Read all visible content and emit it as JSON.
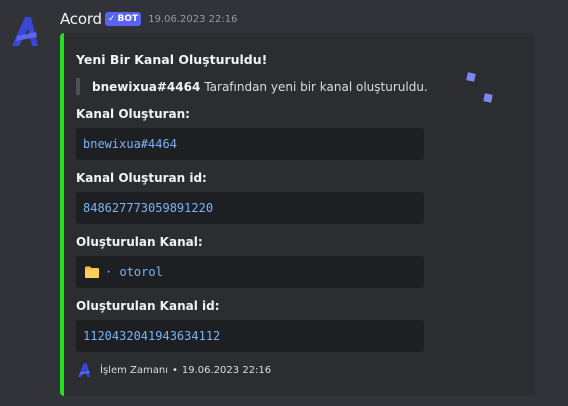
{
  "message": {
    "username": "Acord",
    "bot_tag": "BOT",
    "timestamp": "19.06.2023 22:16"
  },
  "embed": {
    "accent_color": "#22e11d",
    "title": "Yeni Bir Kanal Oluşturuldu!",
    "description_mention": "bnewixua#4464",
    "description_rest": "Tarafından yeni bir kanal oluşturuldu.",
    "fields": [
      {
        "name": "Kanal Oluşturan:",
        "value": "bnewixua#4464"
      },
      {
        "name": "Kanal Oluşturan id:",
        "value": "848627773059891220"
      },
      {
        "name": "Oluşturulan Kanal:",
        "value": "· otorol",
        "icon": "folder-icon"
      },
      {
        "name": "Oluşturulan Kanal id:",
        "value": "1120432041943634112"
      }
    ],
    "footer_text": "İşlem Zamanı",
    "footer_separator": "•",
    "footer_time": "19.06.2023 22:16"
  }
}
